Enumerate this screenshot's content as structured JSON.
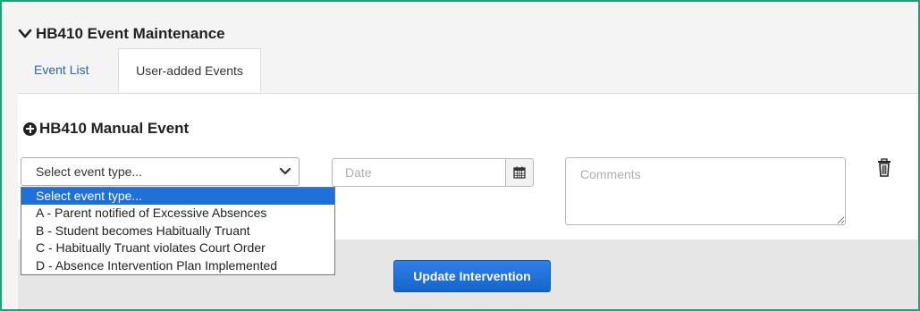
{
  "header": {
    "title": "HB410 Event Maintenance",
    "collapse_icon": "chevron-down-icon"
  },
  "tabs": [
    {
      "label": "Event List",
      "active": false
    },
    {
      "label": "User-added Events",
      "active": true
    }
  ],
  "manual_event": {
    "title": "HB410 Manual Event",
    "icon": "plus-circle-icon",
    "event_type": {
      "selected": "Select event type...",
      "options": [
        "Select event type...",
        "A - Parent notified of Excessive Absences",
        "B - Student becomes Habitually Truant",
        "C - Habitually Truant violates Court Order",
        "D - Absence Intervention Plan Implemented"
      ]
    },
    "date": {
      "placeholder": "Date",
      "value": ""
    },
    "comments": {
      "placeholder": "Comments",
      "value": ""
    },
    "delete_icon": "trash-icon"
  },
  "actions": {
    "update_label": "Update Intervention"
  },
  "colors": {
    "frame_border": "#1aa37a",
    "link": "#2a67b1",
    "selected_option": "#1e71d9",
    "primary_button": "#1464cc"
  }
}
